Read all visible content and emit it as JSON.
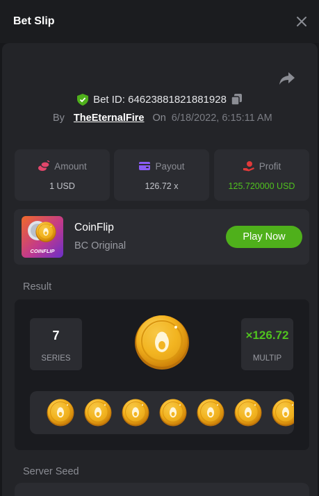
{
  "header": {
    "title": "Bet Slip",
    "close_icon": "close-icon"
  },
  "bet": {
    "id_text": "Bet ID: 64623881821881928",
    "by_label": "By",
    "user": "TheEternalFire",
    "on_label": "On",
    "date": "6/18/2022, 6:15:11 AM"
  },
  "stats": {
    "amount": {
      "label": "Amount",
      "value": "1 USD",
      "icon": "coins-icon"
    },
    "payout": {
      "label": "Payout",
      "value": "126.72 x",
      "icon": "wallet-icon"
    },
    "profit": {
      "label": "Profit",
      "value": "125.720000 USD",
      "icon": "hand-coin-icon"
    }
  },
  "game": {
    "name": "CoinFlip",
    "subtitle": "BC Original",
    "thumb_label": "COINFLIP",
    "play_label": "Play Now"
  },
  "result": {
    "label": "Result",
    "series_value": "7",
    "series_label": "SERIES",
    "multiplier_value": "×126.72",
    "multiplier_label": "MULTIP",
    "coin_count": 7
  },
  "server_seed": {
    "label": "Server Seed"
  },
  "colors": {
    "accent_green": "#50c21f",
    "button_green": "#4fb01b",
    "amount_icon": "#e2466b",
    "payout_icon": "#8b5cf6",
    "profit_icon": "#e03a3a"
  }
}
